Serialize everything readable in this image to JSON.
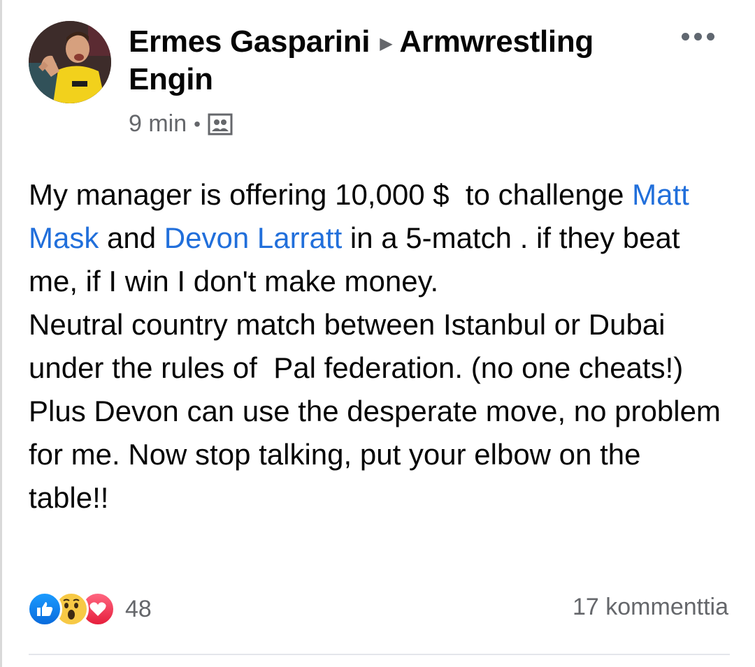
{
  "post": {
    "author": "Ermes Gasparini",
    "group": "Armwrestling Engin",
    "time": "9 min",
    "audience_icon": "group-audience-icon",
    "body": [
      {
        "type": "text",
        "value": "My manager is offering 10,000 $  to challenge "
      },
      {
        "type": "mention",
        "value": "Matt Mask"
      },
      {
        "type": "text",
        "value": " and "
      },
      {
        "type": "mention",
        "value": "Devon Larratt"
      },
      {
        "type": "text",
        "value": " in a 5-match . if they beat me, if I win I don't make money.\nNeutral country match between Istanbul or Dubai under the rules of  Pal federation. (no one cheats!)\nPlus Devon can use the desperate move, no problem for me. Now stop talking, put your elbow on the table!!"
      }
    ],
    "reactions": {
      "icons": [
        "like-icon",
        "wow-icon",
        "love-icon"
      ],
      "count": "48"
    },
    "comments": "17 kommenttia"
  },
  "colors": {
    "mention": "#216fdb",
    "secondary_text": "#65676b",
    "like": "#1877f2",
    "love": "#f33e58",
    "wow": "#f7c945"
  }
}
